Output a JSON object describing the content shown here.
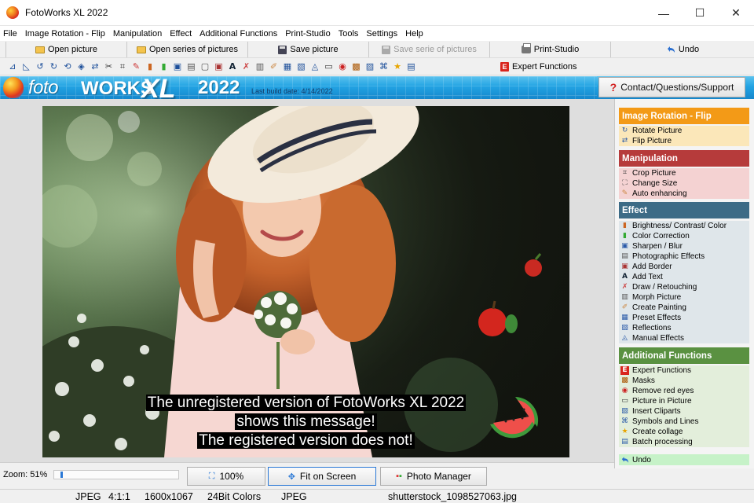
{
  "window": {
    "title": "FotoWorks XL 2022",
    "controls": {
      "minimize": "—",
      "maximize": "☐",
      "close": "✕"
    }
  },
  "menu": [
    "File",
    "Image Rotation - Flip",
    "Manipulation",
    "Effect",
    "Additional Functions",
    "Print-Studio",
    "Tools",
    "Settings",
    "Help"
  ],
  "toolbar": {
    "open_picture": "Open picture",
    "open_series": "Open series of pictures",
    "save_picture": "Save picture",
    "save_series": "Save serie of pictures",
    "print_studio": "Print-Studio",
    "undo": "Undo",
    "expert_functions": "Expert Functions",
    "expert_icon_letter": "E"
  },
  "icon_toolbar": [
    "rotate-left-icon",
    "rotate-right-icon",
    "rotate-ccw-icon",
    "rotate-cw-icon",
    "3d-rotate-icon",
    "cube-icon",
    "flip-icon",
    "cut-icon",
    "crop-icon",
    "wand-icon",
    "brightness-icon",
    "color-icon",
    "sharpen-icon",
    "effects-icon",
    "frame-icon",
    "border-icon",
    "text-icon",
    "brush-icon",
    "morph-icon",
    "paint-icon",
    "preset-icon",
    "reflection-icon",
    "manual-icon",
    "screen-icon",
    "eye-icon",
    "masks-icon",
    "clipart-icon",
    "collage-icon",
    "star-icon",
    "batch-icon"
  ],
  "banner": {
    "logo_foto": "foto",
    "logo_works": "WORKS",
    "logo_xl": "XL",
    "logo_year": "2022",
    "build_date": "Last build date: 4/14/2022",
    "contact_label": "Contact/Questions/Support",
    "contact_icon": "?"
  },
  "nag_message": {
    "line1": "The unregistered version of FotoWorks XL 2022",
    "line2": "shows this message!",
    "line3": "The registered version does not!"
  },
  "sidebar": {
    "sections": [
      {
        "title": "Image Rotation - Flip",
        "color": "#f39a17",
        "item_bg": "#fbe7b9",
        "items": [
          {
            "label": "Rotate Picture",
            "icon": "rotate-icon"
          },
          {
            "label": "Flip Picture",
            "icon": "flip-icon"
          }
        ]
      },
      {
        "title": "Manipulation",
        "color": "#b63b3b",
        "item_bg": "#f4d2d2",
        "items": [
          {
            "label": "Crop Picture",
            "icon": "crop-icon"
          },
          {
            "label": "Change Size",
            "icon": "resize-icon"
          },
          {
            "label": "Auto enhancing",
            "icon": "wand-icon"
          }
        ]
      },
      {
        "title": "Effect",
        "color": "#3d6b86",
        "item_bg": "#dfe6ea",
        "items": [
          {
            "label": "Brightness/ Contrast/ Color",
            "icon": "brightness-icon"
          },
          {
            "label": "Color Correction",
            "icon": "color-correction-icon"
          },
          {
            "label": "Sharpen / Blur",
            "icon": "sharpen-icon"
          },
          {
            "label": "Photographic Effects",
            "icon": "photo-effects-icon"
          },
          {
            "label": "Add Border",
            "icon": "border-icon"
          },
          {
            "label": "Add Text",
            "icon": "text-icon"
          },
          {
            "label": "Draw / Retouching",
            "icon": "draw-icon"
          },
          {
            "label": "Morph Picture",
            "icon": "morph-icon"
          },
          {
            "label": "Create Painting",
            "icon": "painting-icon"
          },
          {
            "label": "Preset Effects",
            "icon": "preset-icon"
          },
          {
            "label": "Reflections",
            "icon": "reflection-icon"
          },
          {
            "label": "Manual Effects",
            "icon": "manual-icon"
          }
        ]
      },
      {
        "title": "Additional Functions",
        "color": "#5a9141",
        "item_bg": "#e3eedb",
        "items": [
          {
            "label": "Expert Functions",
            "icon": "expert-icon"
          },
          {
            "label": "Masks",
            "icon": "masks-icon"
          },
          {
            "label": "Remove red eyes",
            "icon": "eye-icon"
          },
          {
            "label": "Picture in Picture",
            "icon": "pip-icon"
          },
          {
            "label": "Insert Cliparts",
            "icon": "clipart-icon"
          },
          {
            "label": "Symbols and Lines",
            "icon": "symbols-icon"
          },
          {
            "label": "Create collage",
            "icon": "star-icon"
          },
          {
            "label": "Batch processing",
            "icon": "batch-icon"
          }
        ]
      }
    ],
    "undo_label": "Undo"
  },
  "bottom": {
    "zoom_label": "Zoom: 51%",
    "zoom_fraction": 0.05,
    "btn_100": "100%",
    "btn_fit": "Fit on Screen",
    "btn_manager": "Photo Manager"
  },
  "status": {
    "format": "JPEG",
    "sampling": "4:1:1",
    "dimensions": "1600x1067",
    "colors": "24Bit Colors",
    "type": "JPEG",
    "filename": "shutterstock_1098527063.jpg"
  }
}
